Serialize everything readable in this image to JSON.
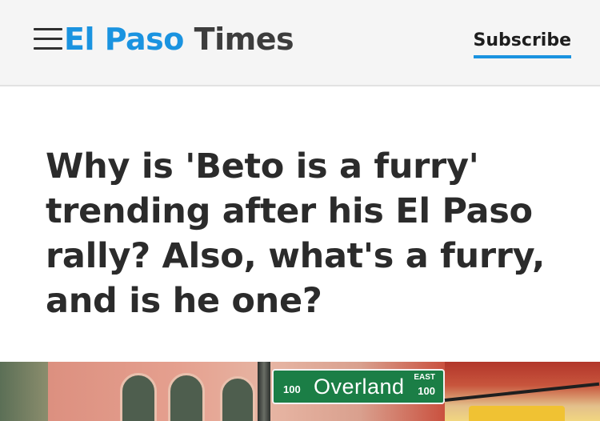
{
  "header": {
    "brand_part_1": "El Paso",
    "brand_part_2": "Times",
    "subscribe_label": "Subscribe",
    "menu_icon": "hamburger-menu-icon",
    "accent_color": "#1a93e0"
  },
  "article": {
    "headline": "Why is 'Beto is a furry' trending after his El Paso rally? Also, what's a furry, and is he one?"
  },
  "hero_image": {
    "street_sign": {
      "number_left": "100",
      "street_name": "Overland",
      "direction": "EAST",
      "number_right": "100"
    }
  }
}
